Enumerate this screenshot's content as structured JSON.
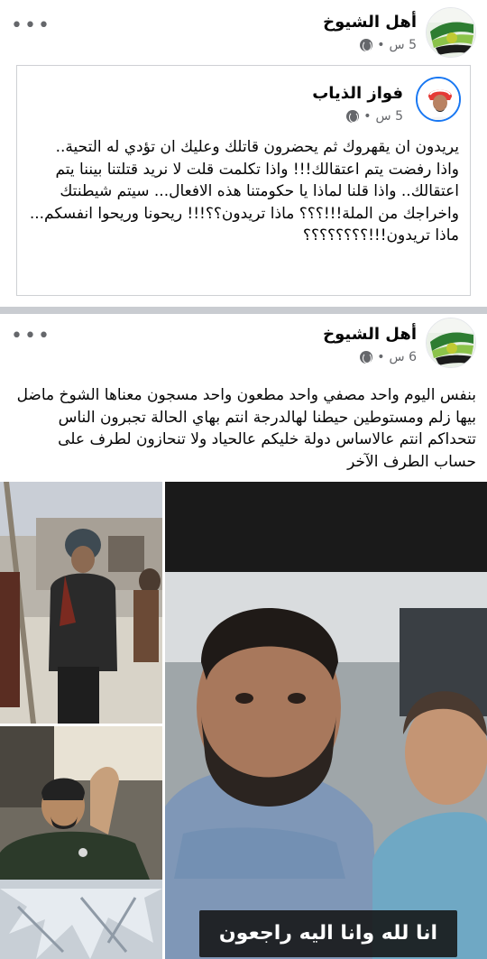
{
  "post1": {
    "page_name": "أهل الشيوخ",
    "time": "5 س",
    "dot": "•",
    "more": "•••",
    "shared": {
      "author": "فواز الذياب",
      "time": "5 س",
      "dot": "•",
      "text": "يريدون ان يقهروك ثم يحضرون قاتلك وعليك ان تؤدي له التحية.. واذا رفضت يتم اعتقالك!!! واذا تكلمت قلت لا نريد قتلتنا بيننا يتم اعتقالك.. واذا قلنا لماذا يا حكومتنا هذه الافعال... سيتم شيطنتك واخراجك من الملة!!!؟؟؟ ماذا تريدون؟؟!!! ريحونا وريحوا انفسكم... ماذا تريدون!!!؟؟؟؟؟؟؟؟"
    }
  },
  "post2": {
    "page_name": "أهل الشيوخ",
    "time": "6 س",
    "dot": "•",
    "more": "•••",
    "text": "بنفس اليوم واحد مصفي واحد مطعون واحد مسجون معناها الشوخ ماضل بيها زلم ومستوطين حيطنا لهالدرجة انتم بهاي الحالة تجبرون الناس تتحداكم انتم عالاساس دولة خليكم عالحياد ولا تنحازون لطرف على حساب الطرف الآخر",
    "video_caption": "انا لله وانا اليه راجعون"
  },
  "colors": {
    "feed_bg": "#c9ccd1",
    "text": "#050505",
    "meta": "#65676b"
  }
}
